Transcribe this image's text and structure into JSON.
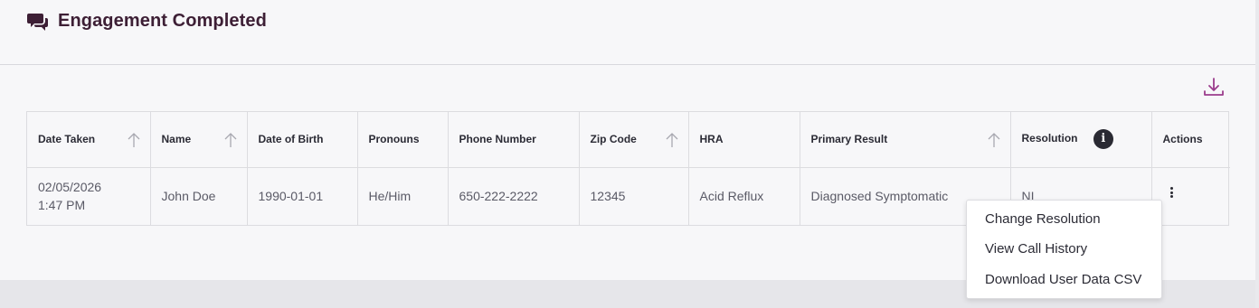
{
  "header": {
    "title": "Engagement Completed",
    "icon": "chat-bubbles-icon"
  },
  "colors": {
    "brand": "#3d1f35",
    "accent": "#9b3c8c"
  },
  "table": {
    "columns": [
      {
        "label": "Date Taken",
        "sortable": true
      },
      {
        "label": "Name",
        "sortable": true
      },
      {
        "label": "Date of Birth",
        "sortable": false
      },
      {
        "label": "Pronouns",
        "sortable": false
      },
      {
        "label": "Phone Number",
        "sortable": false
      },
      {
        "label": "Zip Code",
        "sortable": true
      },
      {
        "label": "HRA",
        "sortable": false
      },
      {
        "label": "Primary Result",
        "sortable": true
      },
      {
        "label": "Resolution",
        "info": true
      },
      {
        "label": "Actions",
        "sortable": false
      }
    ],
    "rows": [
      {
        "date": "02/05/2026",
        "time": "1:47 PM",
        "name": "John Doe",
        "dob": "1990-01-01",
        "pronouns": "He/Him",
        "phone": "650-222-2222",
        "zip": "12345",
        "hra": "Acid Reflux",
        "primary_result": "Diagnosed Symptomatic",
        "resolution": "NI"
      }
    ]
  },
  "info_glyph": "i",
  "actions_menu": {
    "items": [
      "Change Resolution",
      "View Call History",
      "Download User Data CSV"
    ]
  }
}
